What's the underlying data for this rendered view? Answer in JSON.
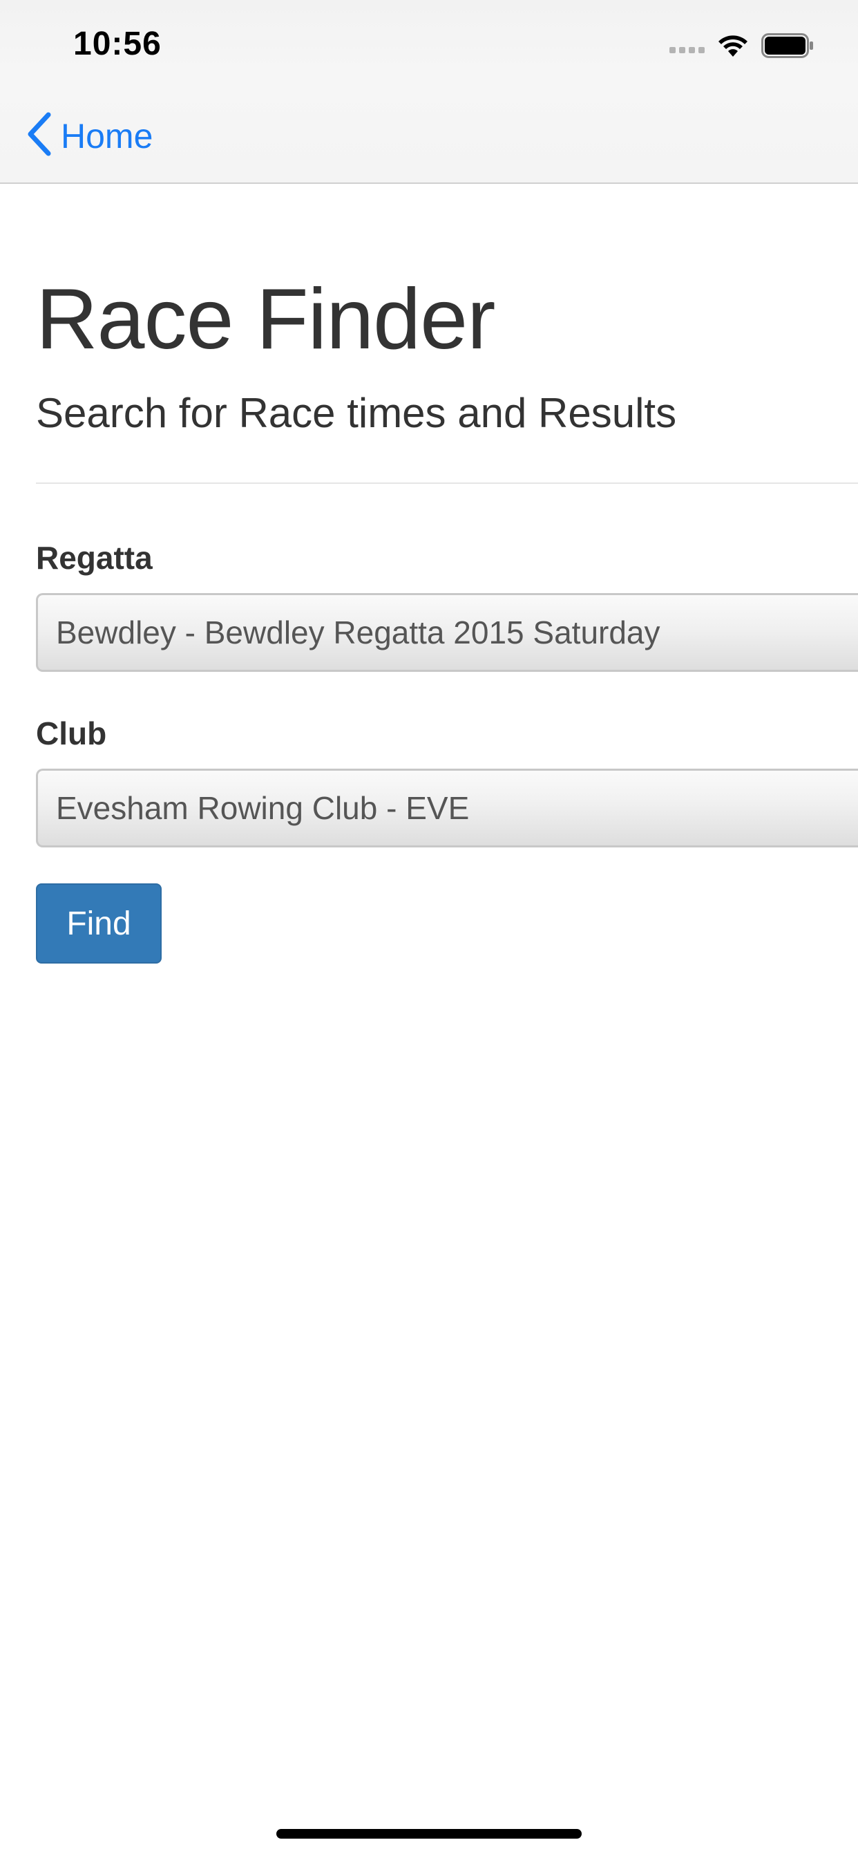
{
  "status_bar": {
    "time": "10:56"
  },
  "nav": {
    "back_label": "Home"
  },
  "page": {
    "title": "Race Finder",
    "subtitle": "Search for Race times and Results"
  },
  "form": {
    "regatta": {
      "label": "Regatta",
      "selected": "Bewdley - Bewdley Regatta 2015 Saturday"
    },
    "club": {
      "label": "Club",
      "selected": "Evesham Rowing Club - EVE"
    },
    "find_label": "Find"
  },
  "colors": {
    "accent": "#1a7cf5",
    "button": "#337ab7",
    "text": "#333333"
  },
  "icons": {
    "back": "chevron-left-icon",
    "wifi": "wifi-icon",
    "battery": "battery-icon",
    "signal": "cellular-signal-icon"
  }
}
